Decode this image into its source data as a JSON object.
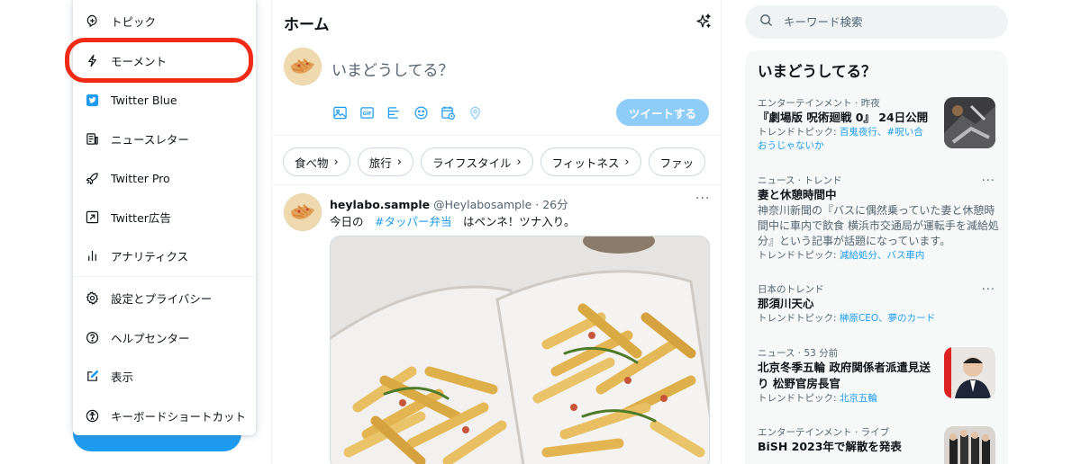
{
  "left_menu": {
    "items": [
      {
        "label": "トピック",
        "icon": "topic-icon"
      },
      {
        "label": "モーメント",
        "icon": "moment-lightning-icon"
      },
      {
        "label": "Twitter Blue",
        "icon": "twitter-blue-icon"
      },
      {
        "label": "ニュースレター",
        "icon": "newsletter-icon"
      },
      {
        "label": "Twitter Pro",
        "icon": "rocket-icon"
      },
      {
        "label": "Twitter広告",
        "icon": "ads-arrow-icon"
      },
      {
        "label": "アナリティクス",
        "icon": "analytics-bars-icon"
      },
      {
        "label": "設定とプライバシー",
        "icon": "gear-icon"
      },
      {
        "label": "ヘルプセンター",
        "icon": "help-icon"
      },
      {
        "label": "表示",
        "icon": "display-edit-icon"
      },
      {
        "label": "キーボードショートカット",
        "icon": "accessibility-icon"
      }
    ],
    "highlighted_item": "モーメント",
    "highlight_color": "#f12a16"
  },
  "home": {
    "title": "ホーム",
    "compose_placeholder": "いまどうしてる？",
    "submit_label": "ツイートする",
    "compose_icons": [
      "image-icon",
      "gif-icon",
      "poll-icon",
      "emoji-icon",
      "schedule-icon",
      "location-icon"
    ],
    "chips": [
      "食べ物",
      "旅行",
      "ライフスタイル",
      "フィットネス",
      "ファッ"
    ]
  },
  "post": {
    "name": "heylabo.sample",
    "handle": "@Heylabosample",
    "time": "26分",
    "text_before": "今日の",
    "hashtag": "#タッパー弁当",
    "text_after": "はペンネ！ツナ入り。",
    "more": "···"
  },
  "search": {
    "placeholder": "キーワード検索"
  },
  "trends": {
    "title": "いまどうしてる？",
    "items": [
      {
        "category": "エンターテインメント · 昨夜",
        "headline": "『劇場版 呪術廻戦 0』 24日公開",
        "topics_label": "トレンドトピック:",
        "topics": "百鬼夜行、#呪い合",
        "topics2": "おうじゃないか"
      },
      {
        "category": "ニュース · トレンド",
        "headline": "妻と休憩時間中",
        "desc": "神奈川新聞の『バスに偶然乗っていた妻と休憩時間中に車内で飲食 横浜市交通局が運転手を減給処分』という記事が話題になっています。",
        "topics_label": "トレンドトピック:",
        "topics": "減給処分、バス車内"
      },
      {
        "category": "日本のトレンド",
        "headline": "那須川天心",
        "topics_label": "トレンドトピック:",
        "topics": "榊原CEO、夢のカード"
      },
      {
        "category": "ニュース · 53 分前",
        "headline": "北京冬季五輪 政府関係者派遣見送り 松野官房長官",
        "topics_label": "トレンドトピック:",
        "topics": "北京五輪"
      },
      {
        "category": "エンターテインメント · ライブ",
        "headline": "BiSH 2023年で解散を発表"
      }
    ],
    "more": "···"
  },
  "colors": {
    "accent": "#1d9bf0",
    "submit_disabled": "#8ecdf8",
    "text": "#0f1419",
    "secondary": "#536471"
  }
}
